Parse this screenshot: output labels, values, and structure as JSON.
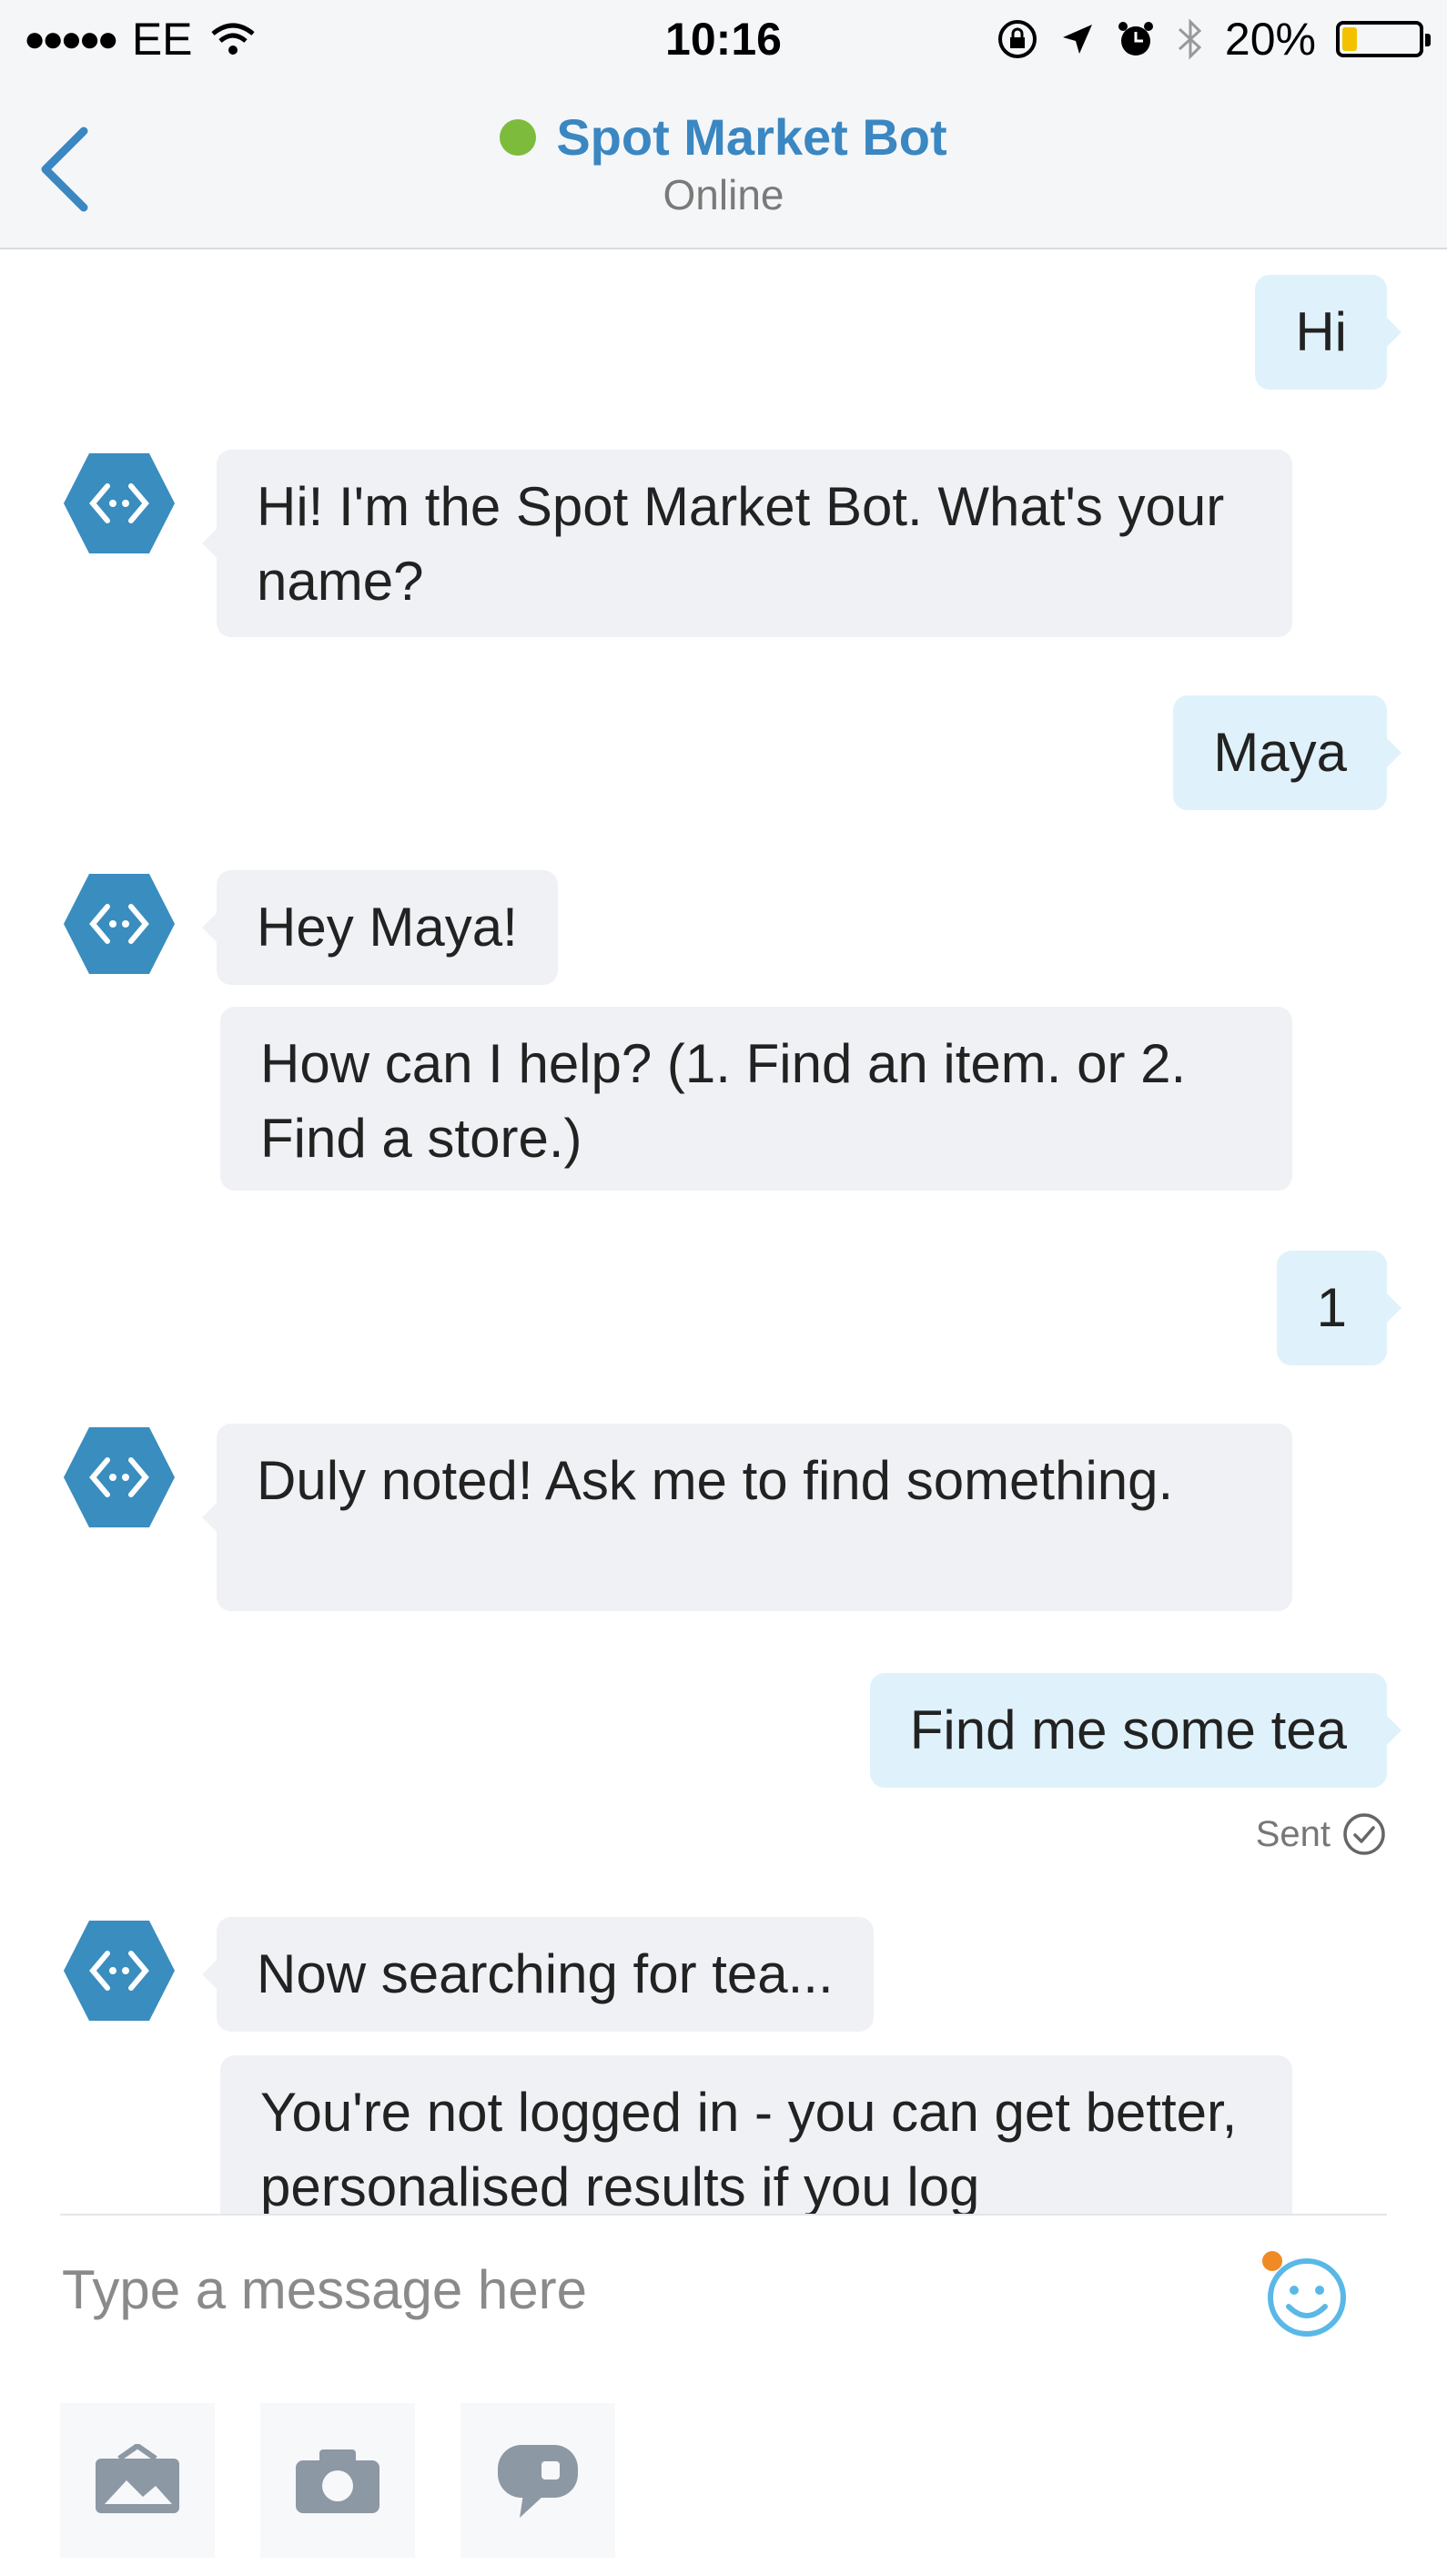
{
  "status_bar": {
    "carrier": "EE",
    "time": "10:16",
    "battery": "20%",
    "battery_level": 0.2
  },
  "header": {
    "title": "Spot Market Bot",
    "subtitle": "Online",
    "colors": {
      "title": "#3a87c2",
      "online_dot": "#7dbb3c"
    }
  },
  "messages": [
    {
      "from": "user",
      "text": "Hi"
    },
    {
      "from": "bot",
      "text": "Hi! I'm the Spot Market Bot. What's your name?"
    },
    {
      "from": "user",
      "text": "Maya"
    },
    {
      "from": "bot",
      "text": "Hey Maya!"
    },
    {
      "from": "bot",
      "text": "How can I help? (1. Find an item. or 2. Find a store.)"
    },
    {
      "from": "user",
      "text": "1"
    },
    {
      "from": "bot",
      "text": "Duly noted! Ask me to find something."
    },
    {
      "from": "user",
      "text": "Find me some tea"
    },
    {
      "from": "bot",
      "text": "Now searching for tea..."
    },
    {
      "from": "bot",
      "text": "You're not logged in - you can get better, personalised results if you log"
    }
  ],
  "sent_status": "Sent",
  "composer": {
    "placeholder": "Type a message here"
  },
  "icons": {
    "back": "chevron-left-icon",
    "bot_avatar": "bot-hexagon-icon",
    "emoji": "smiley-icon",
    "gallery": "gallery-icon",
    "camera": "camera-icon",
    "reply": "chat-bubble-icon",
    "sent": "check-circle-icon"
  },
  "colors": {
    "user_bubble": "#dff2fb",
    "bot_bubble": "#eff1f5",
    "bot_avatar": "#3a8dbf",
    "accent": "#3a87c2"
  }
}
